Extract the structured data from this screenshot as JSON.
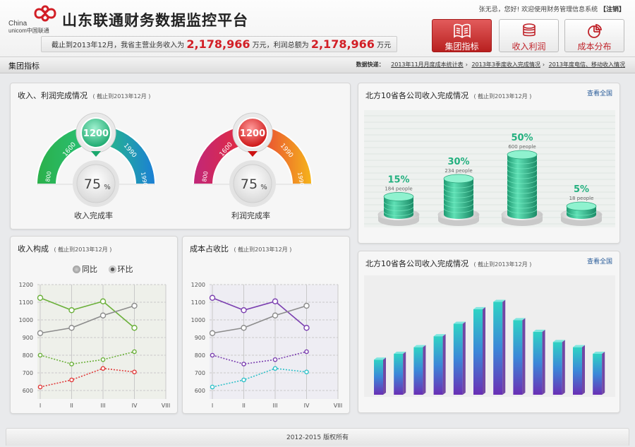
{
  "header": {
    "logo_text_1": "China",
    "logo_text_2": "unicom中国联通",
    "app_title": "山东联通财务数据监控平台",
    "user_greeting": "张无忌，您好! 欢迎使用财务管理信息系统",
    "logout": "【注销】",
    "banner_prefix": "截止到2013年12月，我省主营业务收入为",
    "banner_revenue": "2,178,966",
    "banner_unit1": "万元，利润总额为",
    "banner_profit": "2,178,966",
    "banner_unit2": "万元",
    "nav_buttons": [
      {
        "label": "集团指标",
        "icon": "book-icon",
        "active": true
      },
      {
        "label": "收入利润",
        "icon": "coin-stack-icon",
        "active": false
      },
      {
        "label": "成本分布",
        "icon": "pie-icon",
        "active": false
      }
    ]
  },
  "subnav": {
    "section": "集团指标",
    "quick_label": "数据快递：",
    "links": [
      "2013年11月月度成本统计表",
      "2013年3季度收入完成情况",
      "2013年度电信、移动收入情况"
    ]
  },
  "colors": {
    "brand_red": "#d21f26",
    "gauge_green": "#31b46b",
    "gauge_red": "#e02a2a",
    "purple": "#7b3fb0",
    "green_line": "#6bb03a",
    "teal_bar": "#37c79b"
  },
  "panels": {
    "gauges": {
      "title": "收入、利润完成情况",
      "subtitle": "( 截止到2013年12月 )",
      "gauges": [
        {
          "label": "收入完成率",
          "value": "1200",
          "percent": "75",
          "unit": "%",
          "ticks": [
            "800",
            "1600",
            "1990",
            "1990"
          ],
          "theme": "green"
        },
        {
          "label": "利润完成率",
          "value": "1200",
          "percent": "75",
          "unit": "%",
          "ticks": [
            "800",
            "1600",
            "1990",
            "1990"
          ],
          "theme": "red"
        }
      ]
    },
    "north_top": {
      "title": "北方10省各公司收入完成情况",
      "subtitle": "( 截止到2013年12月 )",
      "link": "查看全国"
    },
    "revenue_mix": {
      "title": "收入构成",
      "subtitle": "( 截止到2013年12月 )",
      "legend": [
        "同比",
        "环比"
      ]
    },
    "cost_ratio": {
      "title": "成本占收比",
      "subtitle": "( 截止到2013年12月 )"
    },
    "north_bottom": {
      "title": "北方10省各公司收入完成情况",
      "subtitle": "( 截止到2013年12月 )",
      "link": "查看全国"
    }
  },
  "chart_data": [
    {
      "type": "bar",
      "style": "3d-cylinder",
      "categories": [
        "",
        "",
        "",
        ""
      ],
      "values": [
        15,
        30,
        50,
        5
      ],
      "labels": [
        "15%",
        "30%",
        "50%",
        "5%"
      ],
      "sublabels": [
        "184 people",
        "234 people",
        "600 people",
        "18 people"
      ],
      "grid": true
    },
    {
      "type": "line",
      "x": [
        "I",
        "II",
        "III",
        "IV"
      ],
      "x_ticks": [
        "I",
        "II",
        "III",
        "IV",
        "VIII"
      ],
      "ylim": [
        600,
        1200
      ],
      "y_ticks": [
        "600",
        "700",
        "800",
        "900",
        "1000",
        "1100",
        "1200"
      ],
      "series": [
        {
          "values": [
            1125,
            1055,
            1105,
            955
          ],
          "color": "#6bb03a",
          "style": "solid"
        },
        {
          "values": [
            925,
            955,
            1025,
            1080
          ],
          "color": "#8c8c8c",
          "style": "solid"
        },
        {
          "values": [
            800,
            750,
            775,
            820
          ],
          "color": "#6bb03a",
          "style": "dotted"
        },
        {
          "values": [
            620,
            660,
            725,
            705
          ],
          "color": "#e03b3b",
          "style": "dotted"
        }
      ],
      "grid": true
    },
    {
      "type": "line",
      "x": [
        "I",
        "II",
        "III",
        "IV"
      ],
      "x_ticks": [
        "I",
        "II",
        "III",
        "IV",
        "VIII"
      ],
      "ylim": [
        600,
        1200
      ],
      "y_ticks": [
        "600",
        "700",
        "800",
        "900",
        "1000",
        "1100",
        "1200"
      ],
      "series": [
        {
          "values": [
            1125,
            1055,
            1105,
            955
          ],
          "color": "#7b3fb0",
          "style": "solid"
        },
        {
          "values": [
            925,
            955,
            1025,
            1080
          ],
          "color": "#8c8c8c",
          "style": "solid"
        },
        {
          "values": [
            800,
            750,
            775,
            820
          ],
          "color": "#7b3fb0",
          "style": "dotted"
        },
        {
          "values": [
            620,
            660,
            725,
            705
          ],
          "color": "#2fc0c8",
          "style": "dotted"
        }
      ],
      "grid": true
    },
    {
      "type": "bar",
      "style": "3d-gradient",
      "values": [
        48,
        56,
        65,
        80,
        97,
        117,
        127,
        102,
        86,
        72,
        65,
        56
      ],
      "ylim": [
        0,
        140
      ],
      "grid": false
    }
  ],
  "footer": {
    "copyright": "2012-2015  版权所有"
  }
}
